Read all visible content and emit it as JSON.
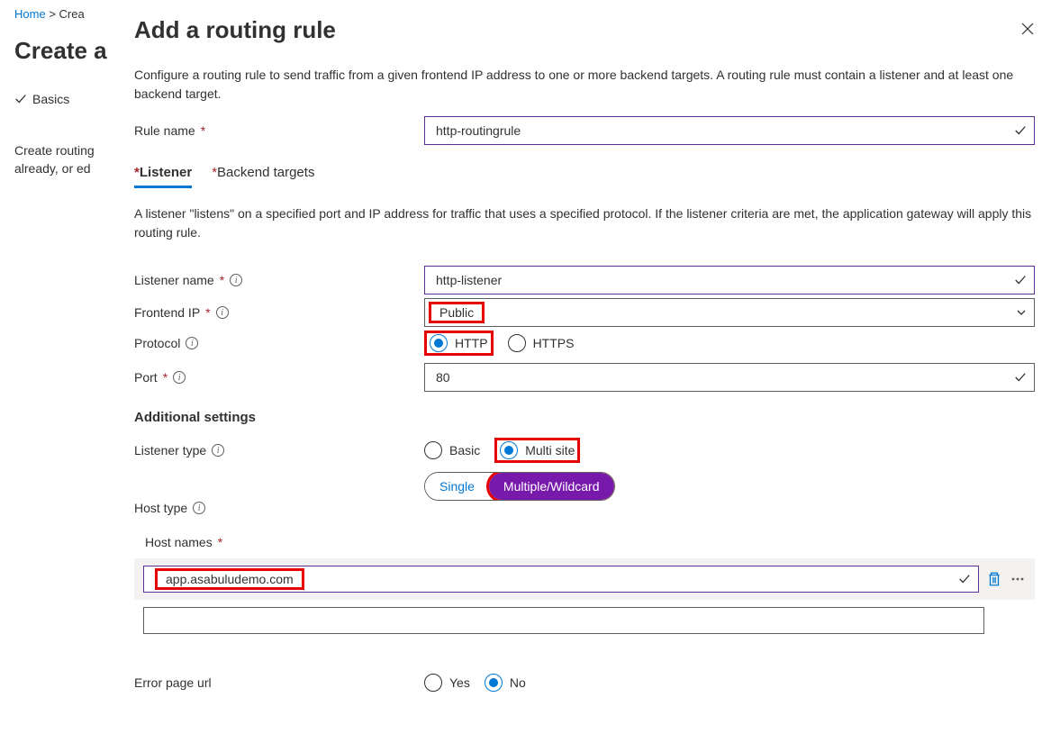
{
  "breadcrumb": {
    "home": "Home",
    "create": "Crea"
  },
  "pageHeader": "Create a",
  "step": "Basics",
  "leftDesc1": "Create routing",
  "leftDesc2": "already, or ed",
  "panel": {
    "title": "Add a routing rule",
    "description": "Configure a routing rule to send traffic from a given frontend IP address to one or more backend targets. A routing rule must contain a listener and at least one backend target.",
    "ruleName": {
      "label": "Rule name",
      "value": "http-routingrule"
    },
    "tabs": {
      "listener": "Listener",
      "backend": "Backend targets"
    },
    "listenerDesc": "A listener \"listens\" on a specified port and IP address for traffic that uses a specified protocol. If the listener criteria are met, the application gateway will apply this routing rule.",
    "listenerName": {
      "label": "Listener name",
      "value": "http-listener"
    },
    "frontendIp": {
      "label": "Frontend IP",
      "value": "Public"
    },
    "protocol": {
      "label": "Protocol",
      "http": "HTTP",
      "https": "HTTPS"
    },
    "port": {
      "label": "Port",
      "value": "80"
    },
    "additionalHeading": "Additional settings",
    "listenerType": {
      "label": "Listener type",
      "basic": "Basic",
      "multi": "Multi site"
    },
    "hostType": {
      "label": "Host type",
      "single": "Single",
      "multiple": "Multiple/Wildcard"
    },
    "hostNames": {
      "label": "Host names",
      "value": "app.asabuludemo.com"
    },
    "errorPage": {
      "label": "Error page url",
      "yes": "Yes",
      "no": "No"
    }
  }
}
